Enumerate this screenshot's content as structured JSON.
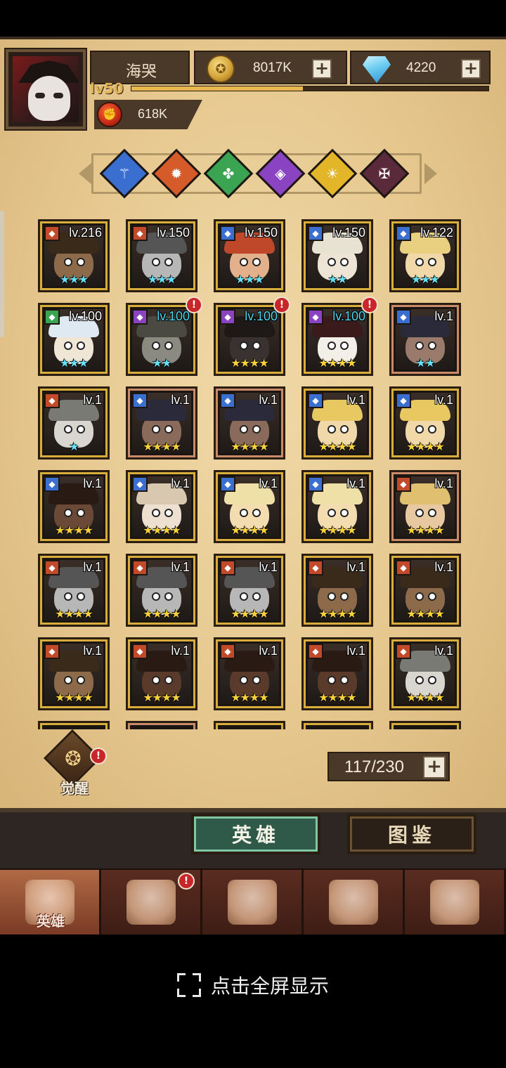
{
  "header": {
    "player_name": "海哭",
    "level": "lv50",
    "xp_fraction": 0.48,
    "gold": "8017K",
    "gems": "4220",
    "power": "618K"
  },
  "factions": [
    {
      "name": "wind-faction-icon",
      "color": "#3a6fd0"
    },
    {
      "name": "fire-faction-icon",
      "color": "#d65b2a"
    },
    {
      "name": "nature-faction-icon",
      "color": "#3aa453"
    },
    {
      "name": "arcane-faction-icon",
      "color": "#8a44c2"
    },
    {
      "name": "light-faction-icon",
      "color": "#e3b62a"
    },
    {
      "name": "dark-faction-icon",
      "color": "#5a2a3a"
    }
  ],
  "heroes": [
    {
      "lv": "lv.216",
      "stars": "★★★",
      "star_color": "cyan",
      "badge": "#c24a2a",
      "frame": "gold",
      "skin": "#8d6b4a",
      "hair": "#3a2a1a",
      "alert": false
    },
    {
      "lv": "lv.150",
      "stars": "★★★",
      "star_color": "cyan",
      "badge": "#c24a2a",
      "frame": "gold",
      "skin": "#b7b7b7",
      "hair": "#555",
      "alert": false
    },
    {
      "lv": "lv.150",
      "stars": "★★★",
      "star_color": "cyan",
      "badge": "#3a6fd0",
      "frame": "gold",
      "skin": "#e2b08a",
      "hair": "#c0482a",
      "alert": false
    },
    {
      "lv": "lv.150",
      "stars": "★★",
      "star_color": "cyan",
      "badge": "#3a6fd0",
      "frame": "gold",
      "skin": "#ede4d6",
      "hair": "#e8e2d2",
      "alert": false
    },
    {
      "lv": "lv.122",
      "stars": "★★★",
      "star_color": "cyan",
      "badge": "#3a6fd0",
      "frame": "gold",
      "skin": "#f0d8a8",
      "hair": "#e8d080",
      "alert": false
    },
    {
      "lv": "lv.100",
      "stars": "★★★",
      "star_color": "cyan",
      "badge": "#3aa453",
      "frame": "gold",
      "skin": "#f0e6d6",
      "hair": "#dfe9f2",
      "alert": false
    },
    {
      "lv": "lv.100",
      "stars": "★★",
      "star_color": "cyan",
      "badge": "#8a44c2",
      "frame": "gold",
      "skin": "#8a8a80",
      "hair": "#4a4a42",
      "alert": true,
      "lv_color": "cyan"
    },
    {
      "lv": "lv.100",
      "stars": "★★★★",
      "star_color": "gold",
      "badge": "#8a44c2",
      "frame": "gold",
      "skin": "#3a3230",
      "hair": "#1e1816",
      "alert": true,
      "lv_color": "cyan"
    },
    {
      "lv": "lv.100",
      "stars": "★★★★",
      "star_color": "gold",
      "badge": "#8a44c2",
      "frame": "gold",
      "skin": "#f2eee8",
      "hair": "#3a1a1a",
      "alert": true,
      "lv_color": "cyan"
    },
    {
      "lv": "lv.1",
      "stars": "★★",
      "star_color": "cyan",
      "badge": "#3a6fd0",
      "frame": "copper",
      "skin": "#9a7a6a",
      "hair": "#2a2a3a",
      "alert": false
    },
    {
      "lv": "lv.1",
      "stars": "★",
      "star_color": "cyan",
      "badge": "#c24a2a",
      "frame": "gold",
      "skin": "#d9d6d0",
      "hair": "#7a7a74",
      "alert": false
    },
    {
      "lv": "lv.1",
      "stars": "★★★★",
      "star_color": "gold",
      "badge": "#3a6fd0",
      "frame": "copper",
      "skin": "#8a6a5a",
      "hair": "#2a2a3a",
      "alert": false
    },
    {
      "lv": "lv.1",
      "stars": "★★★★",
      "star_color": "gold",
      "badge": "#3a6fd0",
      "frame": "copper",
      "skin": "#8a6a5a",
      "hair": "#2a2a3a",
      "alert": false
    },
    {
      "lv": "lv.1",
      "stars": "★★★★",
      "star_color": "gold",
      "badge": "#3a6fd0",
      "frame": "gold",
      "skin": "#f0d8a8",
      "hair": "#e8c860",
      "alert": false
    },
    {
      "lv": "lv.1",
      "stars": "★★★★",
      "star_color": "gold",
      "badge": "#3a6fd0",
      "frame": "gold",
      "skin": "#f0d8a8",
      "hair": "#e8c860",
      "alert": false
    },
    {
      "lv": "lv.1",
      "stars": "★★★★",
      "star_color": "gold",
      "badge": "#3a6fd0",
      "frame": "gold",
      "skin": "#6a4a36",
      "hair": "#2a1a14",
      "alert": false
    },
    {
      "lv": "lv.1",
      "stars": "★★★★",
      "star_color": "gold",
      "badge": "#3a6fd0",
      "frame": "gold",
      "skin": "#ede0d0",
      "hair": "#d8c8b0",
      "alert": false
    },
    {
      "lv": "lv.1",
      "stars": "★★★★",
      "star_color": "gold",
      "badge": "#3a6fd0",
      "frame": "gold",
      "skin": "#f2dcb0",
      "hair": "#efe0a8",
      "alert": false
    },
    {
      "lv": "lv.1",
      "stars": "★★★★",
      "star_color": "gold",
      "badge": "#3a6fd0",
      "frame": "gold",
      "skin": "#f2dcb0",
      "hair": "#efe0a8",
      "alert": false
    },
    {
      "lv": "lv.1",
      "stars": "★★★★",
      "star_color": "gold",
      "badge": "#c24a2a",
      "frame": "copper",
      "skin": "#e8c8a0",
      "hair": "#e0c070",
      "alert": false
    },
    {
      "lv": "lv.1",
      "stars": "★★★★",
      "star_color": "gold",
      "badge": "#c24a2a",
      "frame": "gold",
      "skin": "#b7b7b7",
      "hair": "#555",
      "alert": false
    },
    {
      "lv": "lv.1",
      "stars": "★★★★",
      "star_color": "gold",
      "badge": "#c24a2a",
      "frame": "gold",
      "skin": "#b7b7b7",
      "hair": "#555",
      "alert": false
    },
    {
      "lv": "lv.1",
      "stars": "★★★★",
      "star_color": "gold",
      "badge": "#c24a2a",
      "frame": "gold",
      "skin": "#b7b7b7",
      "hair": "#555",
      "alert": false
    },
    {
      "lv": "lv.1",
      "stars": "★★★★",
      "star_color": "gold",
      "badge": "#c24a2a",
      "frame": "gold",
      "skin": "#8d6b4a",
      "hair": "#3a2a1a",
      "alert": false
    },
    {
      "lv": "lv.1",
      "stars": "★★★★",
      "star_color": "gold",
      "badge": "#c24a2a",
      "frame": "gold",
      "skin": "#8d6b4a",
      "hair": "#3a2a1a",
      "alert": false
    },
    {
      "lv": "lv.1",
      "stars": "★★★★",
      "star_color": "gold",
      "badge": "#c24a2a",
      "frame": "gold",
      "skin": "#8d6b4a",
      "hair": "#3a2a1a",
      "alert": false
    },
    {
      "lv": "lv.1",
      "stars": "★★★★",
      "star_color": "gold",
      "badge": "#c24a2a",
      "frame": "gold",
      "skin": "#5a3a2a",
      "hair": "#2a1a14",
      "alert": false
    },
    {
      "lv": "lv.1",
      "stars": "★★★★",
      "star_color": "gold",
      "badge": "#c24a2a",
      "frame": "gold",
      "skin": "#5a3a2a",
      "hair": "#2a1a14",
      "alert": false
    },
    {
      "lv": "lv.1",
      "stars": "★★★★",
      "star_color": "gold",
      "badge": "#c24a2a",
      "frame": "gold",
      "skin": "#5a3a2a",
      "hair": "#2a1a14",
      "alert": false
    },
    {
      "lv": "lv.1",
      "stars": "★★★★",
      "star_color": "gold",
      "badge": "#c24a2a",
      "frame": "gold",
      "skin": "#d9d6d0",
      "hair": "#7a7a74",
      "alert": false
    }
  ],
  "awaken": {
    "label": "觉醒"
  },
  "capacity": "117/230",
  "subtabs": {
    "heroes": "英雄",
    "codex": "图鉴"
  },
  "bottom_nav": [
    {
      "label": "英雄",
      "icon": "knight-helmet-icon",
      "active": true,
      "alert": false
    },
    {
      "label": "",
      "icon": "ship-wheel-flag-icon",
      "active": false,
      "alert": true
    },
    {
      "label": "",
      "icon": "crossed-swords-icon",
      "active": false,
      "alert": false
    },
    {
      "label": "",
      "icon": "castle-tower-icon",
      "active": false,
      "alert": false
    },
    {
      "label": "",
      "icon": "guild-handshake-icon",
      "active": false,
      "alert": false
    }
  ],
  "fullscreen_prompt": "点击全屏显示"
}
